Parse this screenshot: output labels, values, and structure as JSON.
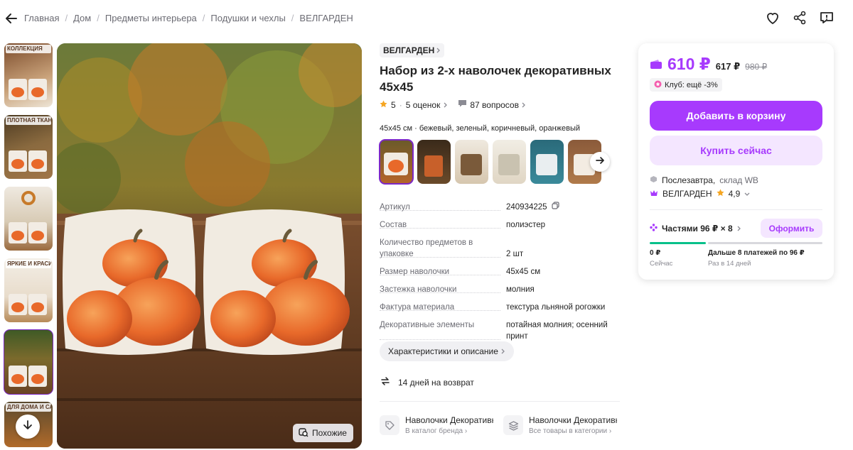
{
  "breadcrumbs": [
    "Главная",
    "Дом",
    "Предметы интерьера",
    "Подушки и чехлы",
    "ВЕЛГАРДЕН"
  ],
  "gallery": {
    "thumbs": [
      {
        "label": "КОЛЛЕКЦИЯ"
      },
      {
        "label": "ПЛОТНАЯ ТКАНЬ"
      },
      {
        "label": ""
      },
      {
        "label": "ЯРКИЕ И КРАСИВЫЕ"
      },
      {
        "label": ""
      },
      {
        "label": "ДЛЯ ДОМА И САДА"
      }
    ],
    "similar_label": "Похожие"
  },
  "product": {
    "brand": "ВЕЛГАРДЕН",
    "title": "Набор из 2-х наволочек декоративных 45х45",
    "rating": "5",
    "reviews": "5 оценок",
    "questions": "87 вопросов",
    "colors_text": "45х45 см · бежевый, зеленый, коричневый, оранжевый",
    "specs": [
      {
        "key": "Артикул",
        "value": "240934225"
      },
      {
        "key": "Состав",
        "value": "полиэстер"
      },
      {
        "key": "Количество предметов в упаковке",
        "value": "2 шт"
      },
      {
        "key": "Размер наволочки",
        "value": "45х45 см"
      },
      {
        "key": "Застежка наволочки",
        "value": "молния"
      },
      {
        "key": "Фактура материала",
        "value": "текстура льняной рогожки"
      },
      {
        "key": "Декоративные элементы",
        "value": "потайная молния; осенний принт"
      }
    ],
    "specs_button": "Характеристики и описание",
    "returns": "14 дней на возврат",
    "links": [
      {
        "title": "Наволочки Декоративные",
        "sub": "В каталог бренда"
      },
      {
        "title": "Наволочки Декоративные",
        "sub": "Все товары в категории"
      }
    ]
  },
  "buy": {
    "price": "610 ₽",
    "price_wallet": "617 ₽",
    "price_old": "980 ₽",
    "club": "Клуб: ещё -3%",
    "add_to_cart": "Добавить в корзину",
    "buy_now": "Купить сейчас",
    "delivery_day": "Послезавтра,",
    "delivery_from": "склад WB",
    "seller": "ВЕЛГАРДЕН",
    "seller_rating": "4,9",
    "installments": "Частями 96 ₽ × 8",
    "order": "Оформить",
    "now_value": "0 ₽",
    "now_label": "Сейчас",
    "next_value": "Дальше 8 платежей по 96 ₽",
    "next_label": "Раз в 14 дней",
    "paid_fraction": 0
  },
  "colors": {
    "accent": "#a73afd",
    "selected_outline": "#7c28c7",
    "progress": "#07c08a"
  },
  "icons": [
    "back-arrow-icon",
    "heart-icon",
    "share-icon",
    "report-icon",
    "star-icon",
    "question-icon",
    "chevron-right-icon",
    "copy-icon",
    "return-icon",
    "tag-icon",
    "layers-icon",
    "wallet-icon",
    "club-icon",
    "box-icon",
    "crown-icon",
    "split-icon",
    "arrow-down-icon",
    "similar-search-icon"
  ]
}
